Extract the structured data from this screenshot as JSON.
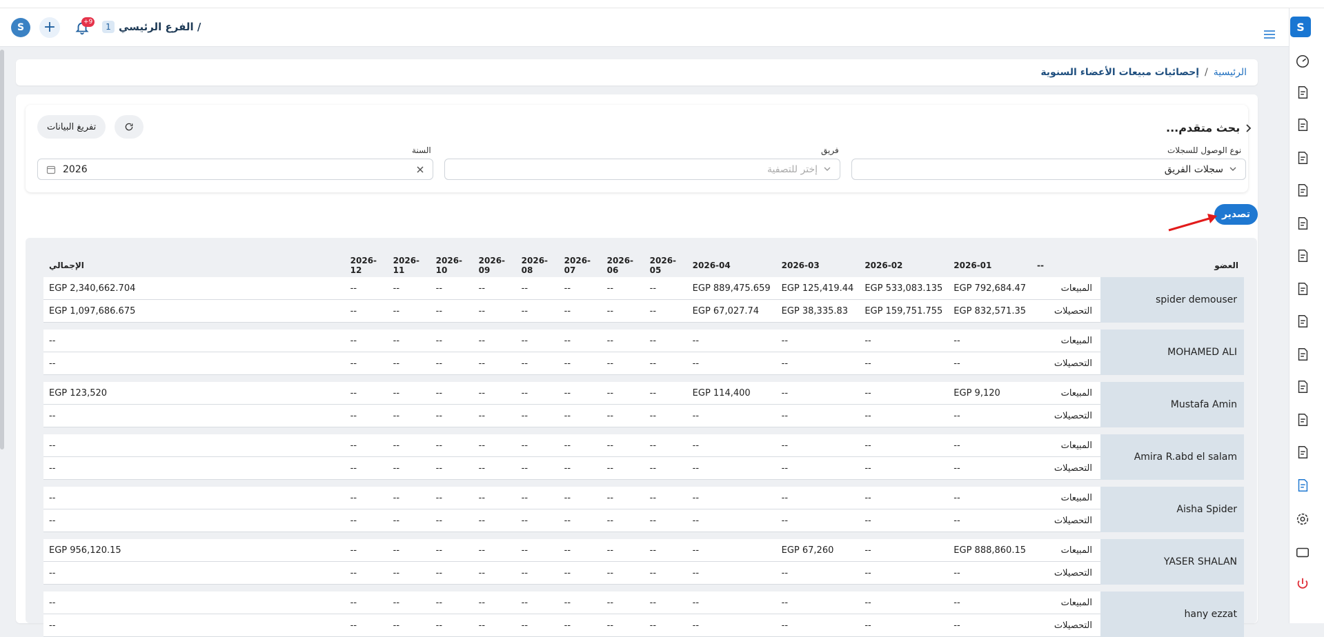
{
  "topbar": {
    "branch_name": "الفرع الرئيسي /",
    "branch_number": "1",
    "notif_badge": "+9"
  },
  "breadcrumb": {
    "home": "الرئيسية",
    "separator": "/",
    "current": "إحصائيات مبيعات الأعضاء السنوية"
  },
  "search": {
    "title": "بحث متقدم...",
    "clear_button": "تفريغ البيانات",
    "access_label": "نوع الوصول للسجلات",
    "access_value": "سجلات الفريق",
    "team_label": "فريق",
    "team_placeholder": "إختر للتصفية",
    "year_label": "السنة",
    "year_value": "2026"
  },
  "export_label": "تصدير",
  "table": {
    "headers": {
      "member": "العضو",
      "type": "--",
      "months": [
        "2026-01",
        "2026-02",
        "2026-03",
        "2026-04",
        "2026-05",
        "2026-06",
        "2026-07",
        "2026-08",
        "2026-09",
        "2026-10",
        "2026-11",
        "2026-12"
      ],
      "total": "الإجمالي"
    },
    "members": [
      {
        "name": "spider demouser",
        "rows": [
          {
            "type": "المبيعات",
            "values": [
              "EGP 792,684.47",
              "EGP 533,083.135",
              "EGP 125,419.44",
              "EGP 889,475.659",
              "--",
              "--",
              "--",
              "--",
              "--",
              "--",
              "--",
              "--"
            ],
            "total": "EGP 2,340,662.704"
          },
          {
            "type": "التحصيلات",
            "values": [
              "EGP 832,571.35",
              "EGP 159,751.755",
              "EGP 38,335.83",
              "EGP 67,027.74",
              "--",
              "--",
              "--",
              "--",
              "--",
              "--",
              "--",
              "--"
            ],
            "total": "EGP 1,097,686.675"
          }
        ]
      },
      {
        "name": "MOHAMED ALI",
        "rows": [
          {
            "type": "المبيعات",
            "values": [
              "--",
              "--",
              "--",
              "--",
              "--",
              "--",
              "--",
              "--",
              "--",
              "--",
              "--",
              "--"
            ],
            "total": "--"
          },
          {
            "type": "التحصيلات",
            "values": [
              "--",
              "--",
              "--",
              "--",
              "--",
              "--",
              "--",
              "--",
              "--",
              "--",
              "--",
              "--"
            ],
            "total": "--"
          }
        ]
      },
      {
        "name": "Mustafa Amin",
        "rows": [
          {
            "type": "المبيعات",
            "values": [
              "EGP 9,120",
              "--",
              "--",
              "EGP 114,400",
              "--",
              "--",
              "--",
              "--",
              "--",
              "--",
              "--",
              "--"
            ],
            "total": "EGP 123,520"
          },
          {
            "type": "التحصيلات",
            "values": [
              "--",
              "--",
              "--",
              "--",
              "--",
              "--",
              "--",
              "--",
              "--",
              "--",
              "--",
              "--"
            ],
            "total": "--"
          }
        ]
      },
      {
        "name": "Amira R.abd el salam",
        "rows": [
          {
            "type": "المبيعات",
            "values": [
              "--",
              "--",
              "--",
              "--",
              "--",
              "--",
              "--",
              "--",
              "--",
              "--",
              "--",
              "--"
            ],
            "total": "--"
          },
          {
            "type": "التحصيلات",
            "values": [
              "--",
              "--",
              "--",
              "--",
              "--",
              "--",
              "--",
              "--",
              "--",
              "--",
              "--",
              "--"
            ],
            "total": "--"
          }
        ]
      },
      {
        "name": "Aisha Spider",
        "rows": [
          {
            "type": "المبيعات",
            "values": [
              "--",
              "--",
              "--",
              "--",
              "--",
              "--",
              "--",
              "--",
              "--",
              "--",
              "--",
              "--"
            ],
            "total": "--"
          },
          {
            "type": "التحصيلات",
            "values": [
              "--",
              "--",
              "--",
              "--",
              "--",
              "--",
              "--",
              "--",
              "--",
              "--",
              "--",
              "--"
            ],
            "total": "--"
          }
        ]
      },
      {
        "name": "YASER SHALAN",
        "rows": [
          {
            "type": "المبيعات",
            "values": [
              "EGP 888,860.15",
              "--",
              "EGP 67,260",
              "--",
              "--",
              "--",
              "--",
              "--",
              "--",
              "--",
              "--",
              "--"
            ],
            "total": "EGP 956,120.15"
          },
          {
            "type": "التحصيلات",
            "values": [
              "--",
              "--",
              "--",
              "--",
              "--",
              "--",
              "--",
              "--",
              "--",
              "--",
              "--",
              "--"
            ],
            "total": "--"
          }
        ]
      },
      {
        "name": "hany ezzat",
        "rows": [
          {
            "type": "المبيعات",
            "values": [
              "--",
              "--",
              "--",
              "--",
              "--",
              "--",
              "--",
              "--",
              "--",
              "--",
              "--",
              "--"
            ],
            "total": "--"
          },
          {
            "type": "التحصيلات",
            "values": [
              "--",
              "--",
              "--",
              "--",
              "--",
              "--",
              "--",
              "--",
              "--",
              "--",
              "--",
              "--"
            ],
            "total": "--"
          }
        ]
      }
    ]
  },
  "sidebar_icons": [
    "dashboard-icon",
    "invoice-icon",
    "cash-register-icon",
    "document-code-icon",
    "document-edit-icon",
    "document-list-icon",
    "document-percent-icon",
    "document-tag-icon",
    "screen-user-icon",
    "user-settings-icon",
    "user-add-icon",
    "money-icon",
    "user-document-icon",
    "report-chart-icon",
    "settings-icon",
    "window-icon",
    "power-icon"
  ],
  "colors": {
    "accent": "#1f78d1",
    "badge": "#e5334a",
    "member_bg": "#d9e2ea",
    "active_icon": "#1f78d1",
    "logout": "#e0303a"
  }
}
